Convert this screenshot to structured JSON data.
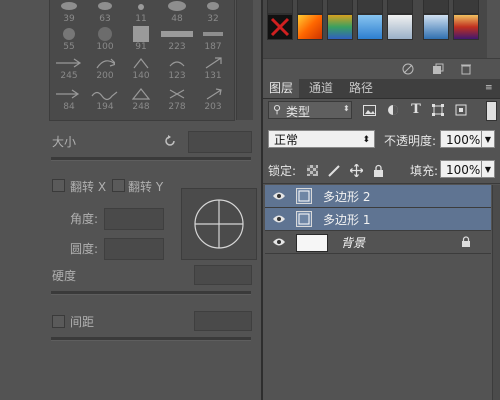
{
  "brush_presets": {
    "row1": [
      "39",
      "63",
      "11",
      "48",
      "32"
    ],
    "row2": [
      "55",
      "100",
      "91",
      "223",
      "187"
    ],
    "row3": [
      "245",
      "200",
      "140",
      "123",
      "131"
    ],
    "row4": [
      "84",
      "194",
      "248",
      "278",
      "203"
    ]
  },
  "brush_settings": {
    "size_label": "大小",
    "flip_x_label": "翻转 X",
    "flip_y_label": "翻转 Y",
    "angle_label": "角度:",
    "roundness_label": "圆度:",
    "hardness_label": "硬度",
    "spacing_label": "间距"
  },
  "layers_panel": {
    "tabs": [
      "图层",
      "通道",
      "路径"
    ],
    "filter_type_label": "类型",
    "blend_mode": "正常",
    "opacity_label": "不透明度:",
    "opacity_value": "100%",
    "lock_label": "锁定:",
    "fill_label": "填充:",
    "fill_value": "100%",
    "layers": [
      {
        "name": "多边形 2",
        "selected": true
      },
      {
        "name": "多边形 1",
        "selected": true
      },
      {
        "name": "背景",
        "selected": false
      }
    ]
  },
  "colors": {
    "selection": "#5f7492",
    "panel_bg": "#535353"
  }
}
